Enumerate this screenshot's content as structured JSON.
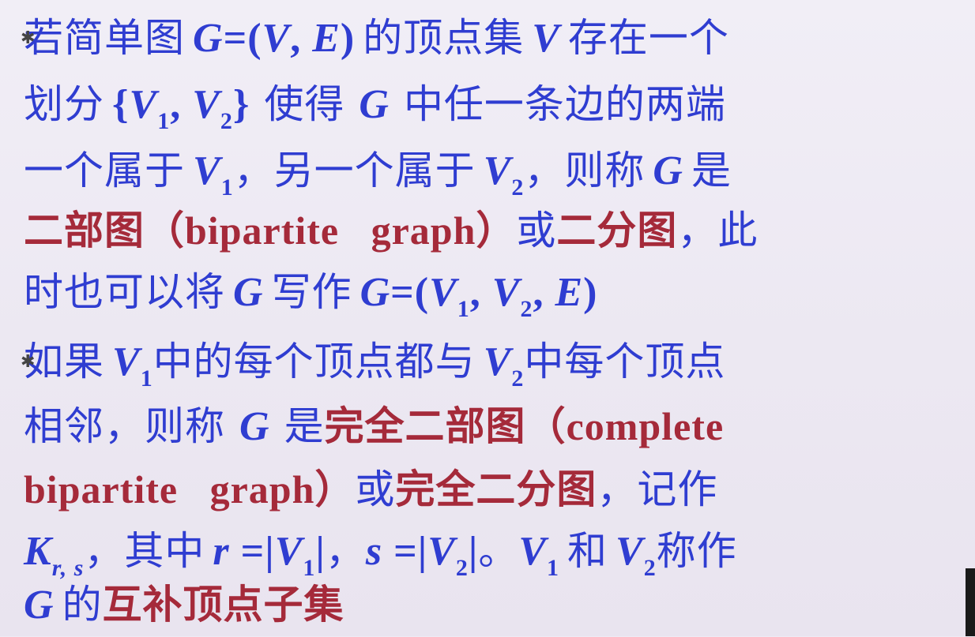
{
  "bullets": [
    "✱",
    "✱"
  ],
  "p1": {
    "l1_a": "若简单图",
    "l1_G": "G",
    "l1_eq": "=(",
    "l1_V": "V",
    "l1_comma": ", ",
    "l1_E": "E",
    "l1_close": ")",
    "l1_b": "的顶点集",
    "l1_V2": "V",
    "l1_c": "存在一个",
    "l2_a": "划分",
    "l2_brace_open": "{",
    "l2_V1": "V",
    "l2_sub1": "1",
    "l2_comma": ", ",
    "l2_V2": "V",
    "l2_sub2": "2",
    "l2_brace_close": "}",
    "l2_b": "使得",
    "l2_G": "G",
    "l2_c": "中任一条边的两端",
    "l3_a": "一个属于",
    "l3_V1": "V",
    "l3_sub1": "1",
    "l3_b": "，另一个属于",
    "l3_V2": "V",
    "l3_sub2": "2",
    "l3_c": "，则称",
    "l3_G": "G",
    "l3_d": "是",
    "l4_red1": "二部图",
    "l4_paren_open": "（",
    "l4_en": "bipartite   graph",
    "l4_paren_close": "）",
    "l4_or": "或",
    "l4_red2": "二分图",
    "l4_tail": "，此",
    "l5_a": "时也可以将",
    "l5_G": "G",
    "l5_b": "写作",
    "l5_G2": "G",
    "l5_eq": "=(",
    "l5_V1": "V",
    "l5_sub1": "1",
    "l5_comma1": ", ",
    "l5_V2": "V",
    "l5_sub2": "2",
    "l5_comma2": ", ",
    "l5_E": "E",
    "l5_close": ")"
  },
  "p2": {
    "l1_a": "如果",
    "l1_V1": "V",
    "l1_sub1": "1",
    "l1_b": "中的每个顶点都与",
    "l1_V2": "V",
    "l1_sub2": "2",
    "l1_c": "中每个顶点",
    "l2_a": "相邻，则称",
    "l2_G": "G",
    "l2_b": "是",
    "l2_red": "完全二部图",
    "l2_paren_open": "（",
    "l2_en": "complete",
    "l3_en": "bipartite   graph",
    "l3_paren_close": "）",
    "l3_or": "或",
    "l3_red": "完全二分图",
    "l3_tail": "，记作",
    "l4_K": "K",
    "l4_Ksub": "r, s",
    "l4_a": "，其中",
    "l4_r": "r",
    "l4_req": " =|",
    "l4_V1": "V",
    "l4_sub1": "1",
    "l4_bar1": "|",
    "l4_b": "，",
    "l4_s": "s",
    "l4_seq": " =|",
    "l4_V2": "V",
    "l4_sub2": "2",
    "l4_bar2": "|",
    "l4_c": "。",
    "l4_V1b": "V",
    "l4_sub1b": "1",
    "l4_d": "和",
    "l4_V2b": "V",
    "l4_sub2b": "2",
    "l4_e": "称作",
    "l5_G": "G",
    "l5_a": "的",
    "l5_red": "互补顶点子集"
  }
}
